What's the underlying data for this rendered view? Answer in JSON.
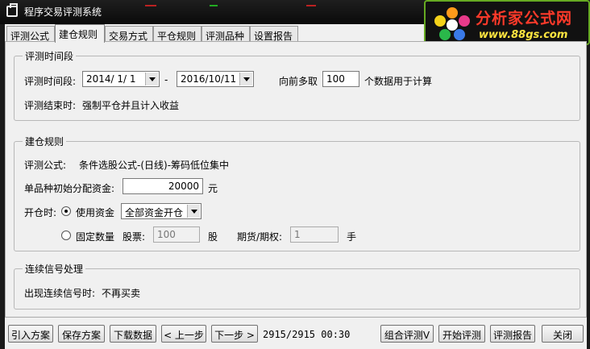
{
  "window": {
    "title": "程序交易评测系统"
  },
  "logo": {
    "name": "分析家公式网",
    "url": "www.88gs.com"
  },
  "tabs": [
    {
      "label": "评测公式"
    },
    {
      "label": "建仓规则"
    },
    {
      "label": "交易方式"
    },
    {
      "label": "平仓规则"
    },
    {
      "label": "评测品种"
    },
    {
      "label": "设置报告"
    }
  ],
  "period": {
    "group_label": "评测时间段",
    "label": "评测时间段:",
    "start_date": "2014/ 1/ 1",
    "dash": "-",
    "end_date": "2016/10/11",
    "lookback_label": "向前多取",
    "lookback_value": "100",
    "lookback_suffix": "个数据用于计算",
    "end_label": "评测结束时:",
    "end_value": "强制平仓并且计入收益"
  },
  "build": {
    "group_label": "建仓规则",
    "formula_label": "评测公式:",
    "formula_value": "条件选股公式-(日线)-筹码低位集中",
    "capital_label": "单品种初始分配资金:",
    "capital_value": "20000",
    "capital_unit": "元",
    "open_label": "开仓时:",
    "use_funds_label": "使用资金",
    "funds_option": "全部资金开仓",
    "fixed_qty_label": "固定数量",
    "stock_label": "股票:",
    "stock_value": "100",
    "stock_unit": "股",
    "futures_label": "期货/期权:",
    "futures_value": "1",
    "futures_unit": "手"
  },
  "signal": {
    "group_label": "连续信号处理",
    "label": "出现连续信号时:",
    "value": "不再买卖"
  },
  "toolbar": {
    "import": "引入方案",
    "save": "保存方案",
    "download": "下载数据",
    "prev": "< 上一步",
    "next": "下一步 >",
    "status": "2915/2915 00:30",
    "combo_eval": "组合评测V",
    "start_eval": "开始评测",
    "report": "评测报告",
    "close": "关闭"
  }
}
